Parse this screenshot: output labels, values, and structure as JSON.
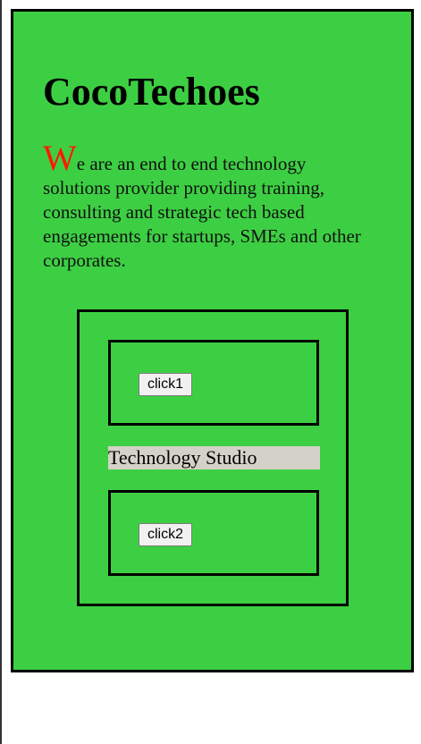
{
  "header": {
    "title": "CocoTechoes"
  },
  "intro": {
    "dropcap": "W",
    "text": "e are an end to end technology solutions provider providing training, consulting and strategic tech based engagements for startups, SMEs and other corporates."
  },
  "panel": {
    "button1_label": "click1",
    "studio_label": "Technology Studio",
    "button2_label": "click2"
  },
  "colors": {
    "card_background": "#3dcf43",
    "dropcap": "#ff1a00",
    "studio_label_background": "#d4d2c8"
  }
}
